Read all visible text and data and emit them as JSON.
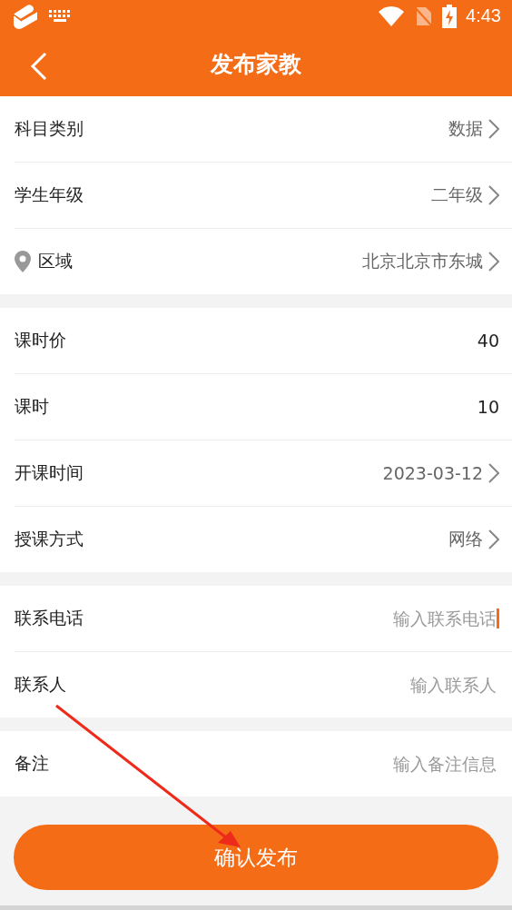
{
  "status_bar": {
    "time": "4:43"
  },
  "header": {
    "title": "发布家教"
  },
  "sections": [
    {
      "rows": [
        {
          "kind": "select",
          "label": "科目类别",
          "value": "数据"
        },
        {
          "kind": "select",
          "label": "学生年级",
          "value": "二年级"
        },
        {
          "kind": "location",
          "label": "区域",
          "value": "北京北京市东城"
        }
      ]
    },
    {
      "rows": [
        {
          "kind": "value",
          "label": "课时价",
          "value": "40"
        },
        {
          "kind": "value",
          "label": "课时",
          "value": "10"
        },
        {
          "kind": "select",
          "label": "开课时间",
          "value": "2023-03-12"
        },
        {
          "kind": "select",
          "label": "授课方式",
          "value": "网络"
        }
      ]
    },
    {
      "rows": [
        {
          "kind": "input",
          "label": "联系电话",
          "placeholder": "输入联系电话",
          "focused": true
        },
        {
          "kind": "input",
          "label": "联系人",
          "placeholder": "输入联系人",
          "focused": false
        }
      ]
    },
    {
      "rows": [
        {
          "kind": "input",
          "label": "备注",
          "placeholder": "输入备注信息",
          "focused": false
        }
      ]
    }
  ],
  "submit_button": "确认发布"
}
